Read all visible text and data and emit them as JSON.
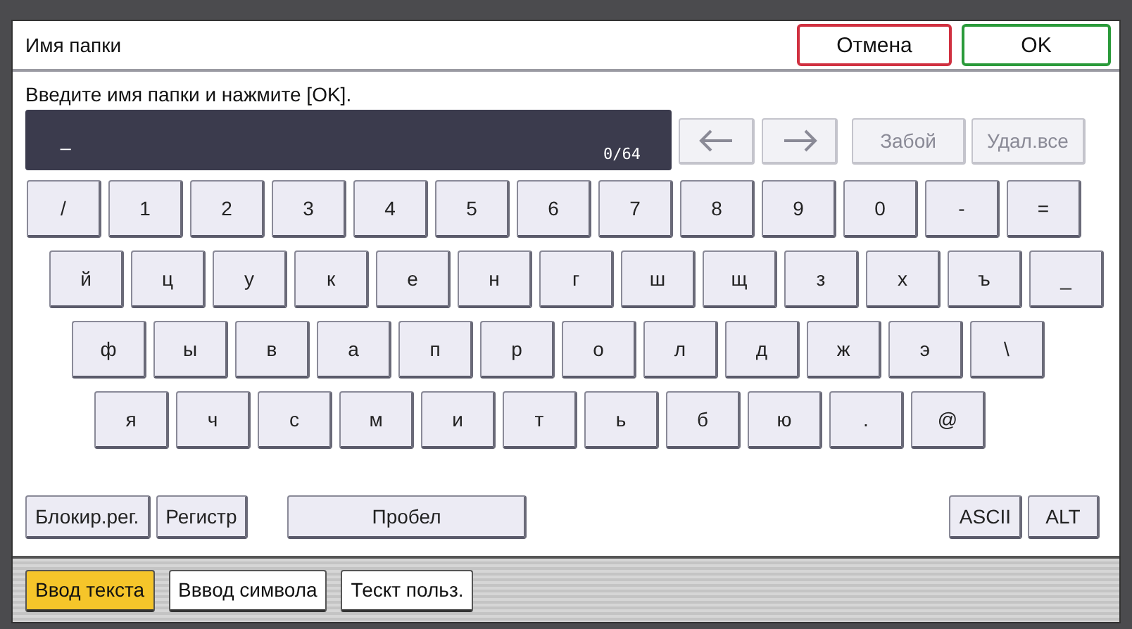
{
  "dialog": {
    "title": "Имя папки",
    "buttons": [
      {
        "label": "Отмена",
        "kind": "cancel"
      },
      {
        "label": "OK",
        "kind": "ok"
      }
    ]
  },
  "prompt": "Введите имя папки и нажмите [OK].",
  "input": {
    "value": "_",
    "counter": "0/64"
  },
  "edit_buttons": [
    {
      "kind": "left",
      "disabled": true
    },
    {
      "kind": "right",
      "disabled": true
    },
    {
      "kind": "text",
      "label": "Забой",
      "disabled": true
    },
    {
      "kind": "text",
      "label": "Удал.все",
      "disabled": true
    }
  ],
  "key_rows": [
    [
      "/",
      "1",
      "2",
      "3",
      "4",
      "5",
      "6",
      "7",
      "8",
      "9",
      "0",
      "-",
      "="
    ],
    [
      "й",
      "ц",
      "у",
      "к",
      "е",
      "н",
      "г",
      "ш",
      "щ",
      "з",
      "х",
      "ъ",
      "_"
    ],
    [
      "ф",
      "ы",
      "в",
      "а",
      "п",
      "р",
      "о",
      "л",
      "д",
      "ж",
      "э",
      "\\"
    ],
    [
      "я",
      "ч",
      "с",
      "м",
      "и",
      "т",
      "ь",
      "б",
      "ю",
      ".",
      "@"
    ]
  ],
  "mode_keys_left": [
    "Блокир.рег.",
    "Регистр"
  ],
  "space_key": "Пробел",
  "mode_keys_right": [
    "ASCII",
    "ALT"
  ],
  "tabs": [
    {
      "label": "Ввод текста",
      "selected": true
    },
    {
      "label": "Вввод символа",
      "selected": false
    },
    {
      "label": "Тескт польз.",
      "selected": false
    }
  ]
}
